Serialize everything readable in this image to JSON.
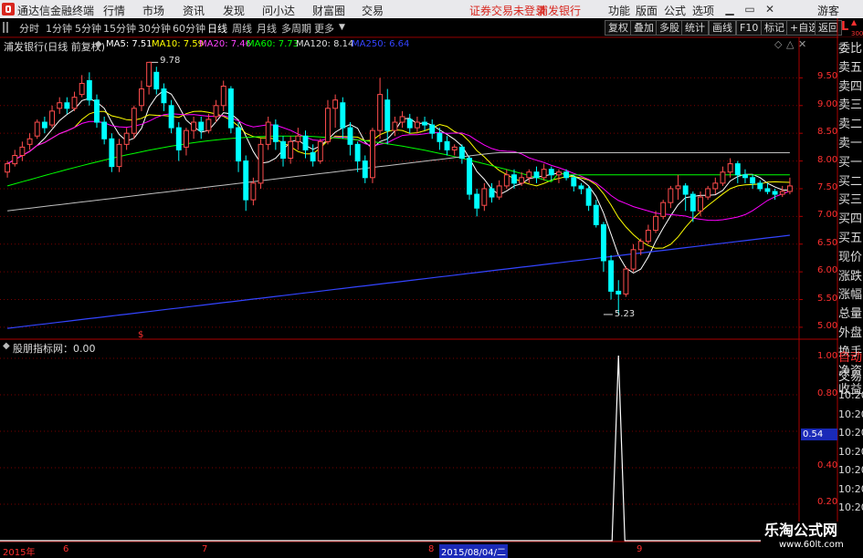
{
  "app": {
    "title": "通达信金融终端",
    "menu": [
      "行情",
      "市场",
      "资讯",
      "发现",
      "问小达",
      "财富圈",
      "交易"
    ],
    "broker_notice": "证券交易未登录",
    "stock_name": "浦发银行",
    "right_menu": [
      "功能",
      "版面",
      "公式",
      "选项"
    ],
    "guest": "游客"
  },
  "tabs": {
    "periods": [
      "分时",
      "1分钟",
      "5分钟",
      "15分钟",
      "30分钟",
      "60分钟",
      "日线",
      "周线",
      "月线",
      "多周期",
      "更多"
    ],
    "active": "日线",
    "tools": [
      "复权",
      "叠加",
      "多股",
      "统计",
      "画线",
      "F10",
      "标记",
      "+自选",
      "返回"
    ]
  },
  "colors": {
    "up": "#ff4d4d",
    "down": "#00ffff",
    "ma5": "#ffffff",
    "ma10": "#ffff00",
    "ma20": "#ff00ff",
    "ma60": "#00ff00",
    "ma120": "#c0c0c0",
    "ma250": "#3344ff",
    "grid": "#7a0000",
    "indicator": "#ffffff"
  },
  "main": {
    "title": "浦发银行(日线 前复权)",
    "ma": [
      {
        "label": "MA5: 7.51",
        "color": "#ffffff"
      },
      {
        "label": "MA10: 7.59",
        "color": "#ffff00"
      },
      {
        "label": "MA20: 7.46",
        "color": "#ff44ff"
      },
      {
        "label": "MA60: 7.73",
        "color": "#00ff00"
      },
      {
        "label": "MA120: 8.14",
        "color": "#dddddd"
      },
      {
        "label": "MA250: 6.64",
        "color": "#3344ff"
      }
    ],
    "high_label": "9.78",
    "low_label": "5.23",
    "marker": "$",
    "corner": {
      "l": "L",
      "num": "300"
    }
  },
  "indicator": {
    "title": "股朋指标网：0.00",
    "current": "0.54",
    "labels": [
      "1.00",
      "0.80",
      "0.54",
      "0.40",
      "0.20"
    ]
  },
  "xaxis": {
    "labels": [
      "2015年",
      "6",
      "7",
      "8",
      "2015/08/04/二",
      "9"
    ]
  },
  "sidebar": {
    "items": [
      "委比",
      "卖五",
      "卖四",
      "卖三",
      "卖二",
      "卖一",
      "买一",
      "买二",
      "买三",
      "买四",
      "买五",
      "现价",
      "涨跌",
      "涨幅",
      "总量",
      "外盘",
      "换手",
      "净资",
      "收益"
    ],
    "lower": [
      "自动",
      "交易",
      "10:20",
      "10:20",
      "10:20",
      "10:20",
      "10:20",
      "10:20",
      "10:20",
      "10:20",
      "10:20"
    ]
  },
  "watermark": {
    "text": "乐淘公式网",
    "url": "www.60lt.com"
  },
  "chart_data": {
    "type": "candlestick",
    "yaxis": {
      "ticks": [
        "9.50",
        "9.00",
        "8.50",
        "8.00",
        "7.50",
        "7.00",
        "6.50",
        "6.00",
        "5.50",
        "5.00"
      ],
      "range": [
        4.9,
        10.0
      ]
    },
    "candles": [
      [
        7.8,
        7.95,
        7.7,
        8.0
      ],
      [
        7.95,
        8.1,
        7.9,
        8.2
      ],
      [
        8.1,
        8.25,
        8.0,
        8.35
      ],
      [
        8.3,
        8.4,
        8.2,
        8.5
      ],
      [
        8.45,
        8.7,
        8.4,
        8.75
      ],
      [
        8.7,
        8.6,
        8.5,
        8.8
      ],
      [
        8.65,
        8.9,
        8.6,
        9.0
      ],
      [
        8.95,
        9.05,
        8.85,
        9.15
      ],
      [
        9.05,
        8.95,
        8.85,
        9.15
      ],
      [
        8.95,
        9.15,
        8.9,
        9.25
      ],
      [
        9.2,
        9.4,
        9.15,
        9.55
      ],
      [
        9.45,
        9.1,
        9.0,
        9.6
      ],
      [
        9.1,
        8.7,
        8.6,
        9.2
      ],
      [
        8.7,
        8.4,
        8.3,
        8.8
      ],
      [
        8.4,
        7.9,
        7.8,
        8.5
      ],
      [
        7.9,
        8.3,
        7.8,
        8.4
      ],
      [
        8.3,
        8.5,
        8.2,
        8.6
      ],
      [
        8.5,
        8.95,
        8.4,
        9.0
      ],
      [
        9.0,
        9.3,
        8.9,
        9.45
      ],
      [
        9.35,
        9.78,
        9.2,
        9.78
      ],
      [
        9.6,
        9.3,
        9.2,
        9.7
      ],
      [
        9.3,
        9.05,
        8.9,
        9.4
      ],
      [
        9.0,
        8.6,
        8.5,
        9.1
      ],
      [
        8.6,
        8.2,
        8.0,
        8.7
      ],
      [
        8.25,
        8.55,
        8.1,
        8.6
      ],
      [
        8.55,
        8.7,
        8.4,
        8.8
      ],
      [
        8.7,
        8.55,
        8.4,
        8.8
      ],
      [
        8.55,
        8.75,
        8.5,
        8.85
      ],
      [
        8.8,
        9.0,
        8.7,
        9.1
      ],
      [
        9.0,
        9.35,
        8.9,
        9.45
      ],
      [
        9.3,
        8.6,
        8.5,
        9.35
      ],
      [
        8.6,
        8.0,
        7.8,
        8.7
      ],
      [
        8.0,
        7.3,
        7.1,
        8.1
      ],
      [
        7.3,
        7.6,
        7.2,
        7.7
      ],
      [
        7.6,
        8.3,
        7.5,
        8.4
      ],
      [
        8.3,
        8.7,
        8.2,
        8.8
      ],
      [
        8.65,
        8.35,
        8.2,
        8.75
      ],
      [
        8.35,
        8.05,
        7.9,
        8.45
      ],
      [
        8.05,
        8.35,
        7.95,
        8.45
      ],
      [
        8.35,
        8.45,
        8.2,
        8.6
      ],
      [
        8.45,
        8.2,
        8.05,
        8.55
      ],
      [
        8.15,
        8.0,
        7.9,
        8.3
      ],
      [
        8.0,
        8.35,
        7.95,
        8.4
      ],
      [
        8.35,
        8.95,
        8.3,
        9.1
      ],
      [
        8.95,
        9.1,
        8.6,
        9.2
      ],
      [
        9.05,
        8.6,
        8.4,
        9.15
      ],
      [
        8.6,
        8.3,
        8.1,
        8.7
      ],
      [
        8.3,
        8.0,
        7.8,
        8.35
      ],
      [
        8.0,
        7.7,
        7.6,
        8.1
      ],
      [
        7.7,
        8.55,
        7.6,
        8.6
      ],
      [
        8.55,
        9.2,
        8.4,
        9.5
      ],
      [
        9.1,
        8.55,
        8.3,
        9.3
      ],
      [
        8.55,
        8.7,
        8.45,
        8.8
      ],
      [
        8.7,
        8.8,
        8.6,
        8.9
      ],
      [
        8.75,
        8.6,
        8.5,
        8.85
      ],
      [
        8.6,
        8.7,
        8.5,
        8.8
      ],
      [
        8.7,
        8.65,
        8.55,
        8.8
      ],
      [
        8.65,
        8.5,
        8.4,
        8.75
      ],
      [
        8.5,
        8.35,
        8.2,
        8.6
      ],
      [
        8.35,
        8.2,
        8.1,
        8.45
      ],
      [
        8.2,
        8.25,
        8.1,
        8.3
      ],
      [
        8.25,
        8.05,
        7.95,
        8.3
      ],
      [
        8.05,
        7.4,
        7.3,
        8.1
      ],
      [
        7.4,
        7.15,
        7.0,
        7.5
      ],
      [
        7.2,
        7.5,
        7.1,
        7.6
      ],
      [
        7.5,
        7.35,
        7.25,
        7.6
      ],
      [
        7.35,
        7.55,
        7.3,
        7.65
      ],
      [
        7.55,
        7.75,
        7.5,
        7.85
      ],
      [
        7.75,
        7.6,
        7.5,
        7.85
      ],
      [
        7.6,
        7.7,
        7.55,
        7.8
      ],
      [
        7.7,
        7.8,
        7.6,
        7.85
      ],
      [
        7.8,
        7.7,
        7.6,
        7.9
      ],
      [
        7.7,
        7.85,
        7.65,
        7.95
      ],
      [
        7.85,
        7.75,
        7.65,
        7.9
      ],
      [
        7.75,
        7.8,
        7.6,
        7.85
      ],
      [
        7.8,
        7.7,
        7.65,
        7.85
      ],
      [
        7.7,
        7.55,
        7.45,
        7.75
      ],
      [
        7.55,
        7.5,
        7.4,
        7.6
      ],
      [
        7.5,
        7.2,
        7.1,
        7.55
      ],
      [
        7.2,
        6.85,
        6.8,
        7.3
      ],
      [
        6.85,
        6.2,
        6.0,
        6.9
      ],
      [
        6.2,
        5.65,
        5.5,
        6.3
      ],
      [
        5.65,
        5.6,
        5.23,
        5.85
      ],
      [
        5.6,
        6.05,
        5.55,
        6.1
      ],
      [
        6.05,
        6.4,
        6.0,
        6.5
      ],
      [
        6.4,
        6.55,
        6.3,
        6.6
      ],
      [
        6.55,
        6.75,
        6.5,
        6.85
      ],
      [
        6.75,
        7.0,
        6.7,
        7.1
      ],
      [
        7.0,
        7.25,
        6.95,
        7.3
      ],
      [
        7.25,
        7.5,
        7.15,
        7.55
      ],
      [
        7.5,
        7.55,
        7.3,
        7.75
      ],
      [
        7.55,
        7.4,
        7.1,
        7.6
      ],
      [
        7.4,
        7.1,
        6.9,
        7.45
      ],
      [
        7.1,
        7.35,
        7.0,
        7.45
      ],
      [
        7.35,
        7.5,
        7.3,
        7.55
      ],
      [
        7.5,
        7.6,
        7.4,
        7.7
      ],
      [
        7.6,
        7.8,
        7.55,
        7.9
      ],
      [
        7.8,
        7.95,
        7.7,
        8.05
      ],
      [
        7.95,
        7.75,
        7.6,
        8.0
      ],
      [
        7.75,
        7.7,
        7.6,
        7.85
      ],
      [
        7.7,
        7.6,
        7.5,
        7.75
      ],
      [
        7.6,
        7.5,
        7.45,
        7.65
      ],
      [
        7.5,
        7.45,
        7.4,
        7.6
      ],
      [
        7.45,
        7.4,
        7.3,
        7.5
      ],
      [
        7.4,
        7.45,
        7.35,
        7.55
      ],
      [
        7.45,
        7.55,
        7.4,
        7.7
      ]
    ],
    "spike_index": 82
  }
}
